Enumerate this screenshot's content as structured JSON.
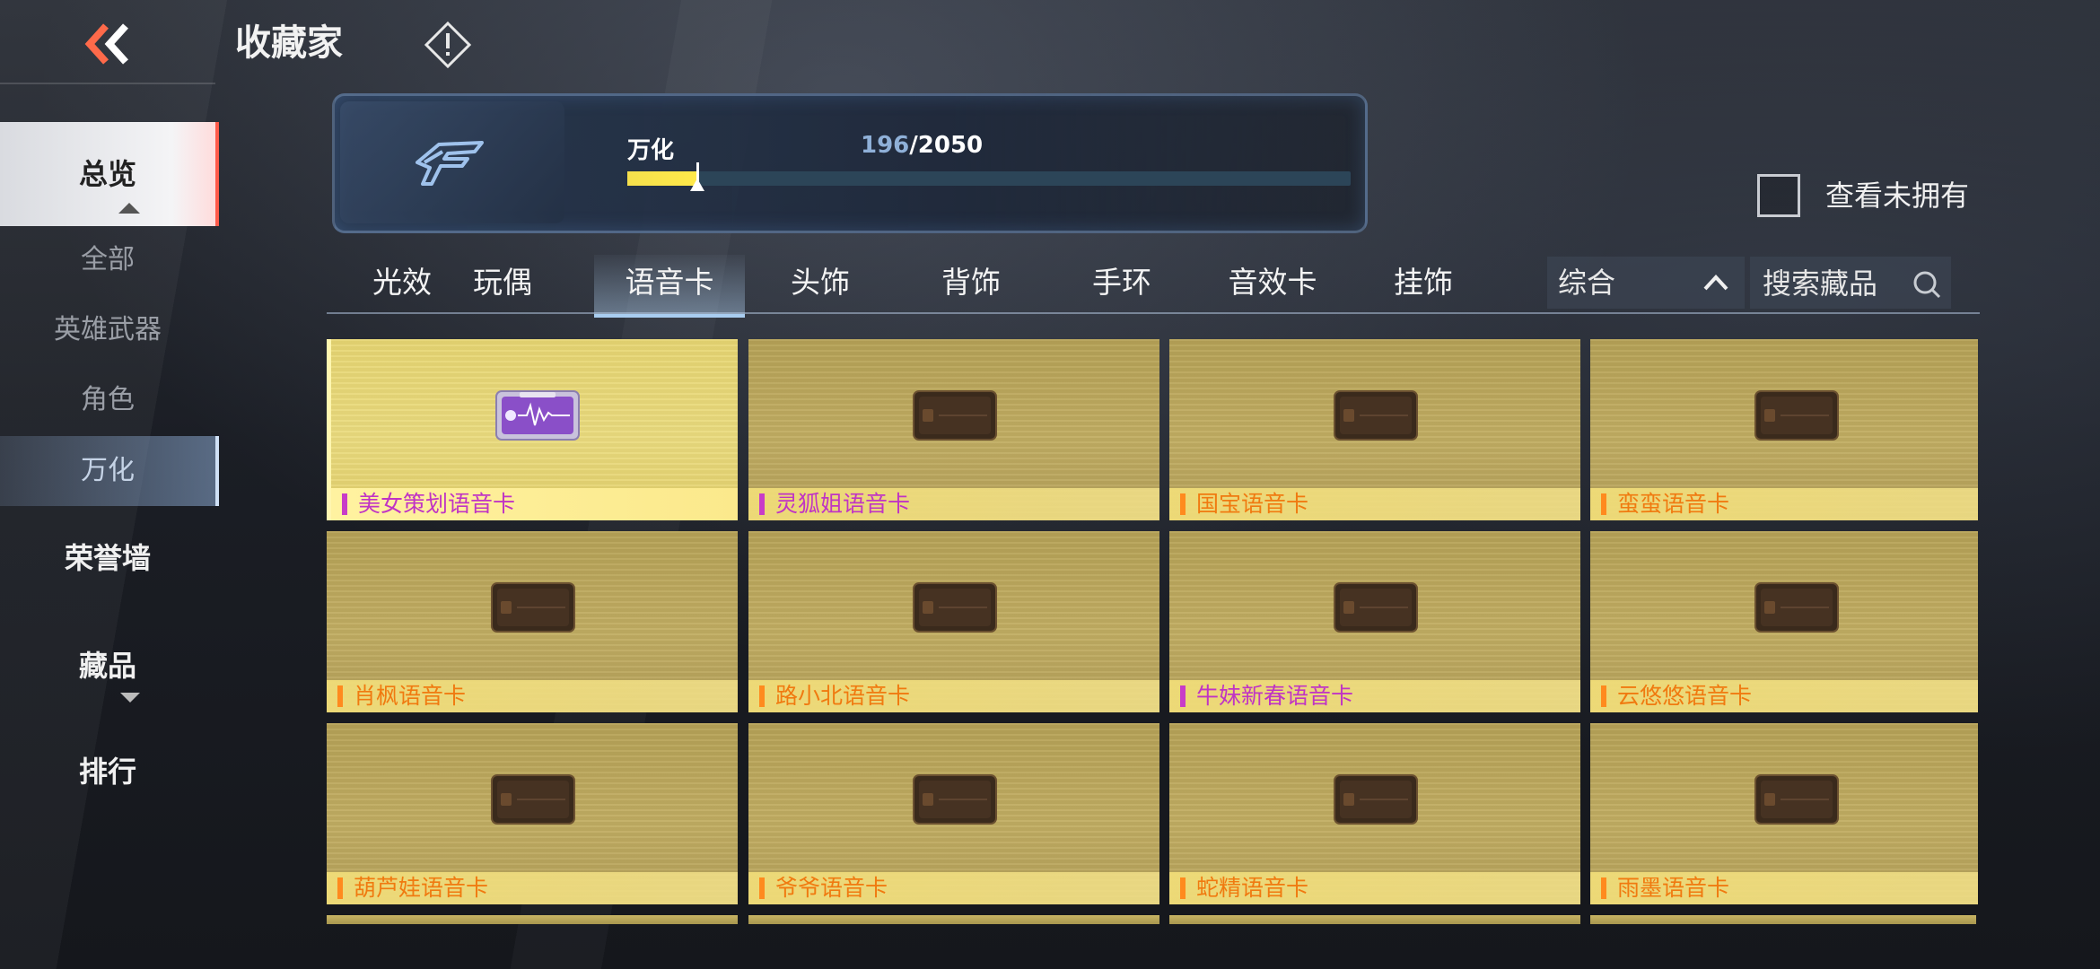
{
  "header": {
    "title": "收藏家"
  },
  "sidebar": {
    "overview": "总览",
    "sub_items": [
      "全部",
      "英雄武器",
      "角色",
      "万化"
    ],
    "honor_wall": "荣誉墙",
    "collection": "藏品",
    "ranking": "排行"
  },
  "progress": {
    "label": "万化",
    "owned": "196",
    "separator": "/",
    "total": "2050",
    "fraction": 0.0956
  },
  "filter": {
    "view_unowned_label": "查看未拥有",
    "view_unowned_checked": false
  },
  "tabs": [
    {
      "label": "光效",
      "active": false
    },
    {
      "label": "玩偶",
      "active": false
    },
    {
      "label": "语音卡",
      "active": true
    },
    {
      "label": "头饰",
      "active": false
    },
    {
      "label": "背饰",
      "active": false
    },
    {
      "label": "手环",
      "active": false
    },
    {
      "label": "音效卡",
      "active": false
    },
    {
      "label": "挂饰",
      "active": false
    }
  ],
  "sort": {
    "selected": "综合"
  },
  "search": {
    "placeholder": "搜索藏品"
  },
  "items": [
    {
      "name": "美女策划语音卡",
      "rarity": "purple",
      "owned": true,
      "selected": true
    },
    {
      "name": "灵狐姐语音卡",
      "rarity": "purple",
      "owned": false,
      "selected": false
    },
    {
      "name": "国宝语音卡",
      "rarity": "orange",
      "owned": false,
      "selected": false
    },
    {
      "name": "蛮蛮语音卡",
      "rarity": "orange",
      "owned": false,
      "selected": false
    },
    {
      "name": "肖枫语音卡",
      "rarity": "orange",
      "owned": false,
      "selected": false
    },
    {
      "name": "路小北语音卡",
      "rarity": "orange",
      "owned": false,
      "selected": false
    },
    {
      "name": "牛妹新春语音卡",
      "rarity": "purple",
      "owned": false,
      "selected": false
    },
    {
      "name": "云悠悠语音卡",
      "rarity": "orange",
      "owned": false,
      "selected": false
    },
    {
      "name": "葫芦娃语音卡",
      "rarity": "orange",
      "owned": false,
      "selected": false
    },
    {
      "name": "爷爷语音卡",
      "rarity": "orange",
      "owned": false,
      "selected": false
    },
    {
      "name": "蛇精语音卡",
      "rarity": "orange",
      "owned": false,
      "selected": false
    },
    {
      "name": "雨墨语音卡",
      "rarity": "orange",
      "owned": false,
      "selected": false
    }
  ],
  "colors": {
    "accent_red": "#ff5a4a",
    "progress_yellow": "#ffe94a",
    "rarity_orange": "#f07a10",
    "rarity_purple": "#c034c4",
    "card_gold": "#c2ae63"
  },
  "icons": {
    "back": "double-chevron-left-icon",
    "info": "exclamation-diamond-icon",
    "logo": "cf-logo-icon",
    "sort": "chevron-up-icon",
    "search": "search-icon",
    "item": "voice-card-icon"
  }
}
